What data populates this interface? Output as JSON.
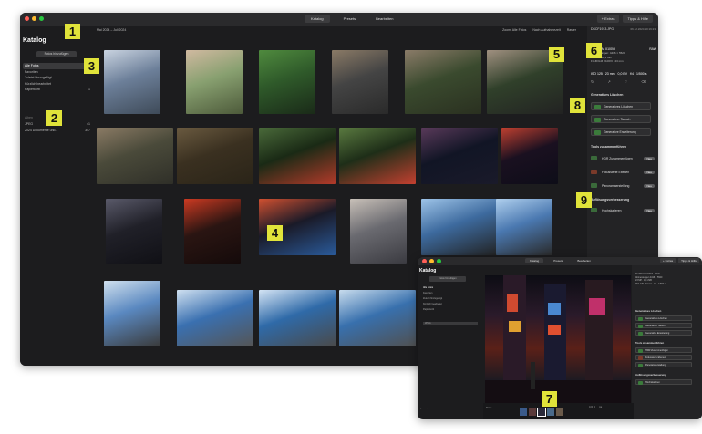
{
  "main_window": {
    "tabs": [
      {
        "label": "Katalog",
        "active": true
      },
      {
        "label": "Presets",
        "active": false
      },
      {
        "label": "Bearbeiten",
        "active": false
      }
    ],
    "toolbar_right": [
      "+ Extras",
      "Tipps & Hilfe"
    ],
    "sidebar": {
      "title": "Katalog",
      "import_button": "Fotos hinzufügen",
      "items": [
        {
          "label": "Alle Fotos",
          "count": "588",
          "selected": true
        },
        {
          "label": "Favoriten",
          "count": "",
          "selected": false
        },
        {
          "label": "Zuletzt hinzugefügt",
          "count": "",
          "selected": false
        },
        {
          "label": "Kürzlich bearbeitet",
          "count": "",
          "selected": false
        },
        {
          "label": "Papierkorb",
          "count": "1",
          "selected": false
        },
        {
          "label": "",
          "count": "",
          "selected": false
        }
      ],
      "section_albums": "Alben",
      "albums": [
        {
          "label": "JPEG",
          "count": "41"
        },
        {
          "label": "2024 Dokumente und...",
          "count": "347"
        }
      ]
    },
    "main": {
      "date_range": "Mai 2024 – Juli 2024",
      "header_controls": [
        "Zoom: Alle Fotos",
        "Nach Aufnahmezeit",
        "Raster"
      ],
      "photos": [
        {
          "name": "city-tower",
          "colors": [
            "#6c7f99",
            "#c9d3e0",
            "#3e4a58"
          ]
        },
        {
          "name": "woman-flowers",
          "colors": [
            "#88a070",
            "#d0b9a0",
            "#4d5a3a"
          ]
        },
        {
          "name": "pond-trees",
          "colors": [
            "#2f5a2a",
            "#4f8a3e",
            "#1a2a18"
          ]
        },
        {
          "name": "squirrel-rock",
          "colors": [
            "#444",
            "#8a7a66",
            "#2a2a2a"
          ]
        },
        {
          "name": "squirrel-sitting",
          "colors": [
            "#3a4a2e",
            "#8a7b68",
            "#2a3020"
          ]
        },
        {
          "name": "squirrel-close",
          "colors": [
            "#30402a",
            "#a09080",
            "#222"
          ]
        },
        {
          "name": "squirrel-wide-1",
          "colors": [
            "#4a4a3a",
            "#8b7b65",
            "#2f2f28"
          ]
        },
        {
          "name": "squirrel-tree",
          "colors": [
            "#3a3020",
            "#6a5a40",
            "#2a2418"
          ]
        },
        {
          "name": "squirrel-apple-1",
          "colors": [
            "#1a2a15",
            "#4a6a3a",
            "#b33a2a"
          ]
        },
        {
          "name": "squirrel-apple-2",
          "colors": [
            "#1e2e18",
            "#5a7a40",
            "#c44030"
          ]
        },
        {
          "name": "times-square-night-1",
          "colors": [
            "#111525",
            "#5a3a5a",
            "#1a1a2a"
          ]
        },
        {
          "name": "times-square-night-2",
          "colors": [
            "#1a1020",
            "#c04030",
            "#0d0d18"
          ]
        },
        {
          "name": "street-sign-night",
          "colors": [
            "#202028",
            "#5a5a6a",
            "#101015"
          ]
        },
        {
          "name": "hand-sign-red",
          "colors": [
            "#2a1512",
            "#cc3a22",
            "#140a0a"
          ]
        },
        {
          "name": "times-square-wide",
          "colors": [
            "#1a1a28",
            "#d05030",
            "#2a5a9a"
          ]
        },
        {
          "name": "woman-building",
          "colors": [
            "#6a6a70",
            "#c8c0b8",
            "#3a3a40"
          ]
        },
        {
          "name": "bridge-view-1",
          "colors": [
            "#3d6a9e",
            "#9ec4e8",
            "#222"
          ]
        },
        {
          "name": "man-bridge",
          "colors": [
            "#4a78b0",
            "#b0d0ee",
            "#2a2a2a"
          ]
        },
        {
          "name": "woman-bridge-portrait",
          "colors": [
            "#5a88c0",
            "#d0e0ee",
            "#3a3a3a"
          ]
        },
        {
          "name": "dance-bridge-1",
          "colors": [
            "#3a70b0",
            "#cfe0f0",
            "#555"
          ]
        },
        {
          "name": "dance-bridge-2",
          "colors": [
            "#2f6aa8",
            "#d4e4f4",
            "#4a4a4a"
          ]
        },
        {
          "name": "dance-bridge-3",
          "colors": [
            "#3870ad",
            "#c8dced",
            "#505050"
          ]
        }
      ]
    },
    "right_panel": {
      "filename": "DSCF1913.JPG",
      "date": "06.12.2024 10:19:23",
      "camera": "FUJIFILM X100VI",
      "format_tag": "RAW",
      "meta_lines": [
        "Abmessungen: 4416 × 5520",
        "23 MP · 10,1 MB",
        "FUJIFILM X100VI · 23 mm"
      ],
      "exif": [
        "ISO 125",
        "23 mm",
        "0,0 EV",
        "f/4",
        "1/500 s"
      ],
      "sec_generative": "Generatives Löschen",
      "gen_buttons": [
        "Generatives Löschen",
        "Generativer Tausch",
        "Generative Erweiterung"
      ],
      "sec_tools": "Tools zusammenführen",
      "tools": [
        {
          "label": "HDR Zusammenfügen",
          "tag": "Neu",
          "color": "#3a6a3a"
        },
        {
          "label": "Fokussierte Ebenen",
          "tag": "Neu",
          "color": "#7a3a2a"
        },
        {
          "label": "Panoramaerstellung",
          "tag": "Neu",
          "color": "#3a6a3a"
        }
      ],
      "sec_resolution": "Auflösungsverbesserung",
      "resolution_item": {
        "label": "Hochskalieren",
        "tag": "Neu"
      }
    }
  },
  "secondary_window": {
    "tabs": [
      {
        "label": "Katalog",
        "active": true
      },
      {
        "label": "Presets",
        "active": false
      },
      {
        "label": "Bearbeiten",
        "active": false
      }
    ],
    "toolbar_right": [
      "+ Extras",
      "Tipps & Hilfe"
    ],
    "sidebar_title": "Katalog",
    "import_button": "Fotos hinzufügen",
    "items": [
      "Alle Fotos",
      "Favoriten",
      "Zuletzt hinzugefügt",
      "Kürzlich bearbeitet",
      "Papierkorb"
    ],
    "album": "JPEG",
    "right_meta": [
      "FUJIFILM X100VI · RAW",
      "Abmessungen 4416 × 5520",
      "23 MP · 10,1 MB",
      "ISO 125 · 23 mm · f/4 · 1/500 s"
    ],
    "right_sections": [
      "Generatives Löschen",
      "Tools zusammenführen",
      "Auflösungsverbesserung"
    ],
    "right_buttons_gen": [
      "Generatives Löschen",
      "Generativer Tausch",
      "Generative Erweiterung"
    ],
    "right_buttons_tools": [
      "HDR Zusammenfügen",
      "Fokussierte Ebenen",
      "Panoramaerstellung"
    ],
    "right_buttons_res": [
      "Hochskalieren"
    ],
    "film_label": "Reise",
    "footer_right": [
      "100 %",
      "Aa"
    ]
  },
  "badges": [
    "1",
    "2",
    "3",
    "4",
    "5",
    "6",
    "7",
    "8",
    "9"
  ],
  "colors": {
    "badge": "#e0e33a",
    "window_bg": "#1c1c1e",
    "panel_bg": "#232325"
  }
}
